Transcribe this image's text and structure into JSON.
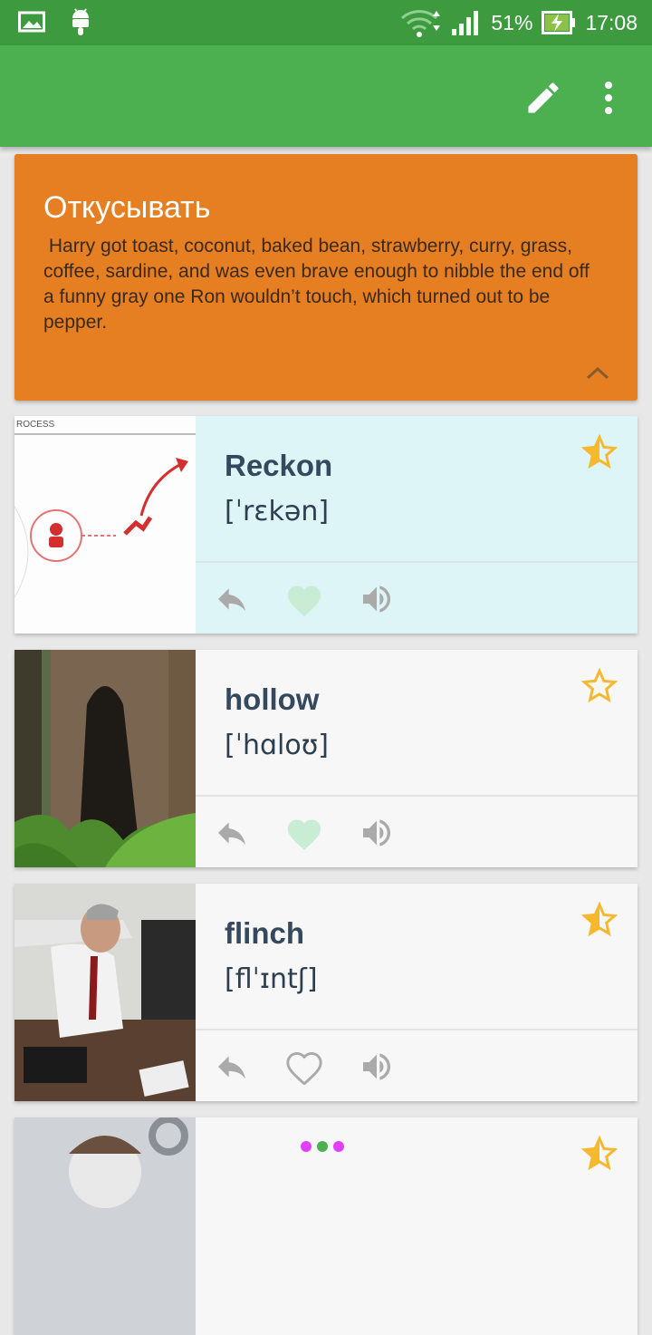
{
  "status_bar": {
    "battery": "51%",
    "time": "17:08"
  },
  "definition_card": {
    "title": "Откусывать",
    "example": " Harry got toast, coconut, baked bean, strawberry, curry, grass, coffee, sardine, and was even brave enough to nibble the end off a funny gray one Ron wouldn’t touch, which turned out to be pepper."
  },
  "words": [
    {
      "word": "Reckon",
      "phonetic": "[ˈrɛkən]",
      "favorite": true,
      "star": "half",
      "highlighted": true
    },
    {
      "word": "hollow",
      "phonetic": "[ˈhɑloʊ]",
      "favorite": true,
      "star": "empty",
      "highlighted": false
    },
    {
      "word": "flinch",
      "phonetic": "[flˈɪntʃ]",
      "favorite": false,
      "star": "half",
      "highlighted": false
    },
    {
      "word": "",
      "phonetic": "",
      "favorite": false,
      "star": "half",
      "highlighted": false
    }
  ],
  "colors": {
    "status_bar": "#3d9a3f",
    "app_bar": "#4caf50",
    "definition_card": "#e67e22",
    "star": "#f5b82e",
    "heart_active": "#c8ecd4",
    "highlight_panel": "#def5f8"
  }
}
